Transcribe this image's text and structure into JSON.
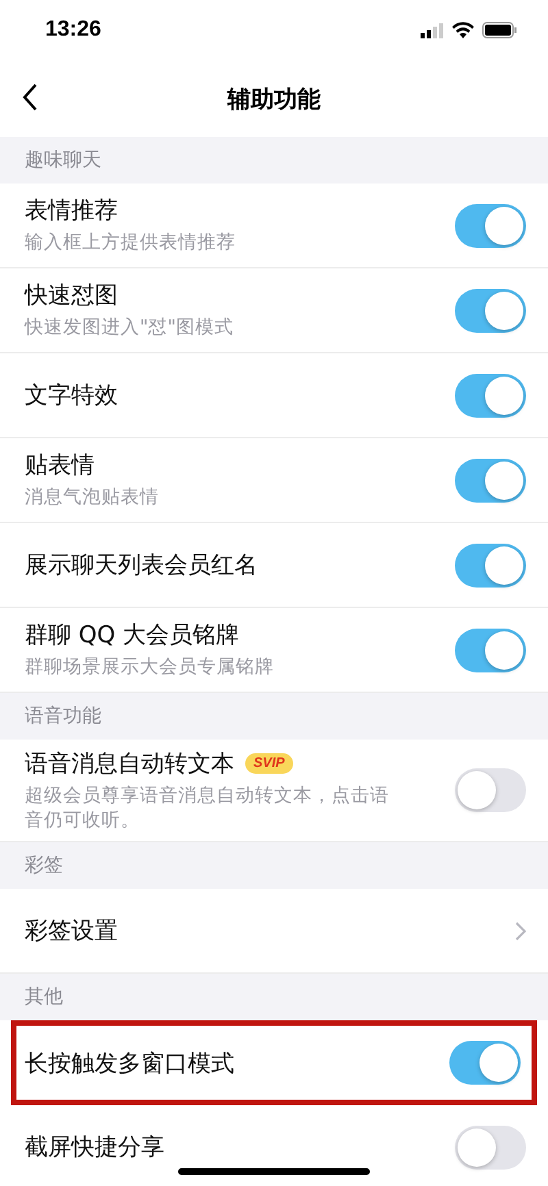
{
  "status_bar": {
    "time": "13:26"
  },
  "nav": {
    "title": "辅助功能"
  },
  "sections": [
    {
      "header": "趣味聊天",
      "items": [
        {
          "kind": "toggle",
          "title": "表情推荐",
          "subtitle": "输入框上方提供表情推荐",
          "on": true,
          "highlighted": false
        },
        {
          "kind": "toggle",
          "title": "快速怼图",
          "subtitle": "快速发图进入\"怼\"图模式",
          "on": true,
          "highlighted": false
        },
        {
          "kind": "toggle",
          "title": "文字特效",
          "on": true,
          "highlighted": false
        },
        {
          "kind": "toggle",
          "title": "贴表情",
          "subtitle": "消息气泡贴表情",
          "on": true,
          "highlighted": false
        },
        {
          "kind": "toggle",
          "title": "展示聊天列表会员红名",
          "on": true,
          "highlighted": false
        },
        {
          "kind": "toggle",
          "title": "群聊 QQ 大会员铭牌",
          "subtitle": "群聊场景展示大会员专属铭牌",
          "on": true,
          "highlighted": false
        }
      ]
    },
    {
      "header": "语音功能",
      "items": [
        {
          "kind": "toggle",
          "title": "语音消息自动转文本",
          "badge": "SVIP",
          "subtitle": "超级会员尊享语音消息自动转文本，点击语音仍可收听。",
          "on": false,
          "highlighted": false
        }
      ]
    },
    {
      "header": "彩签",
      "items": [
        {
          "kind": "link",
          "title": "彩签设置",
          "highlighted": false
        }
      ]
    },
    {
      "header": "其他",
      "items": [
        {
          "kind": "toggle",
          "title": "长按触发多窗口模式",
          "on": true,
          "highlighted": true
        },
        {
          "kind": "toggle",
          "title": "截屏快捷分享",
          "on": false,
          "highlighted": false
        }
      ]
    }
  ]
}
